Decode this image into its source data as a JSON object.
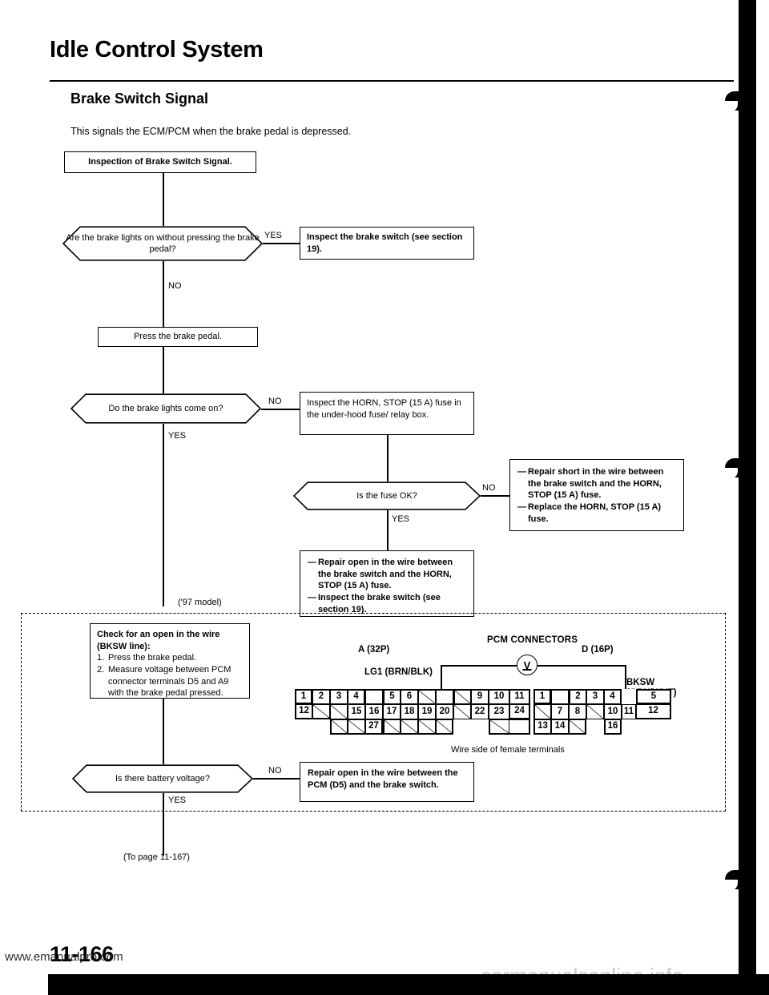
{
  "header": {
    "title": "Idle Control System",
    "section_title": "Brake Switch Signal",
    "intro": "This signals the ECM/PCM when the brake pedal is depressed."
  },
  "flow": {
    "start_box": "Inspection of Brake Switch Signal.",
    "q1": "Are the brake lights on without pressing the brake pedal?",
    "q1_yes": "YES",
    "q1_no": "NO",
    "q1_yes_box": "Inspect the brake switch (see section 19).",
    "action1": "Press the brake pedal.",
    "q2": "Do the brake lights come on?",
    "q2_no": "NO",
    "q2_yes": "YES",
    "q2_no_box": "Inspect the HORN, STOP (15 A) fuse in the under-hood fuse/ relay box.",
    "q3": "Is the fuse OK?",
    "q3_no": "NO",
    "q3_yes": "YES",
    "q3_no_box": [
      "Repair short in the wire between the brake switch and the HORN, STOP (15 A) fuse.",
      "Replace the HORN, STOP (15 A) fuse."
    ],
    "q3_yes_box": [
      "Repair open in the wire between the brake switch and the HORN, STOP (15 A) fuse.",
      "Inspect the brake switch (see section 19)."
    ],
    "model_note": "('97 model)",
    "check_box": {
      "heading_line1": "Check for an open in the wire",
      "heading_line2": "(BKSW line):",
      "steps": [
        "Press the brake pedal.",
        "Measure voltage between PCM connector terminals D5 and A9 with the brake pedal pressed."
      ]
    },
    "q4": "Is there battery voltage?",
    "q4_no": "NO",
    "q4_yes": "YES",
    "q4_no_box": "Repair open in the wire between the PCM (D5) and the brake switch.",
    "to_page": "(To page 11-167)"
  },
  "connectors": {
    "title": "PCM CONNECTORS",
    "a_label": "A (32P)",
    "d_label": "D (16P)",
    "lg1_label": "LG1 (BRN/BLK)",
    "bksw_label_line1": "BKSW",
    "bksw_label_line2": "(GRN/WHT)",
    "meter": "V",
    "caption": "Wire side of female terminals",
    "a_rows": [
      [
        "1",
        "2",
        "3",
        "4",
        "",
        "5",
        "6",
        "",
        "",
        "",
        "9",
        "10",
        "11"
      ],
      [
        "12",
        "",
        "",
        "15",
        "16",
        "17",
        "18",
        "19",
        "20",
        "",
        "22",
        "23",
        "24"
      ],
      [
        "",
        "",
        "",
        "27",
        "",
        "",
        "",
        "",
        "",
        "",
        "",
        "",
        ""
      ]
    ],
    "d_rows": [
      [
        "1",
        "",
        "2",
        "3",
        "4",
        "",
        "5"
      ],
      [
        "",
        "7",
        "8",
        "",
        "10",
        "11",
        "12"
      ],
      [
        "13",
        "14",
        "",
        "16",
        "",
        "",
        ""
      ]
    ]
  },
  "footer": {
    "page_number": "11-166",
    "watermark_left": "www.emanualpro.com",
    "watermark_right": "carmanualsonline.info"
  }
}
